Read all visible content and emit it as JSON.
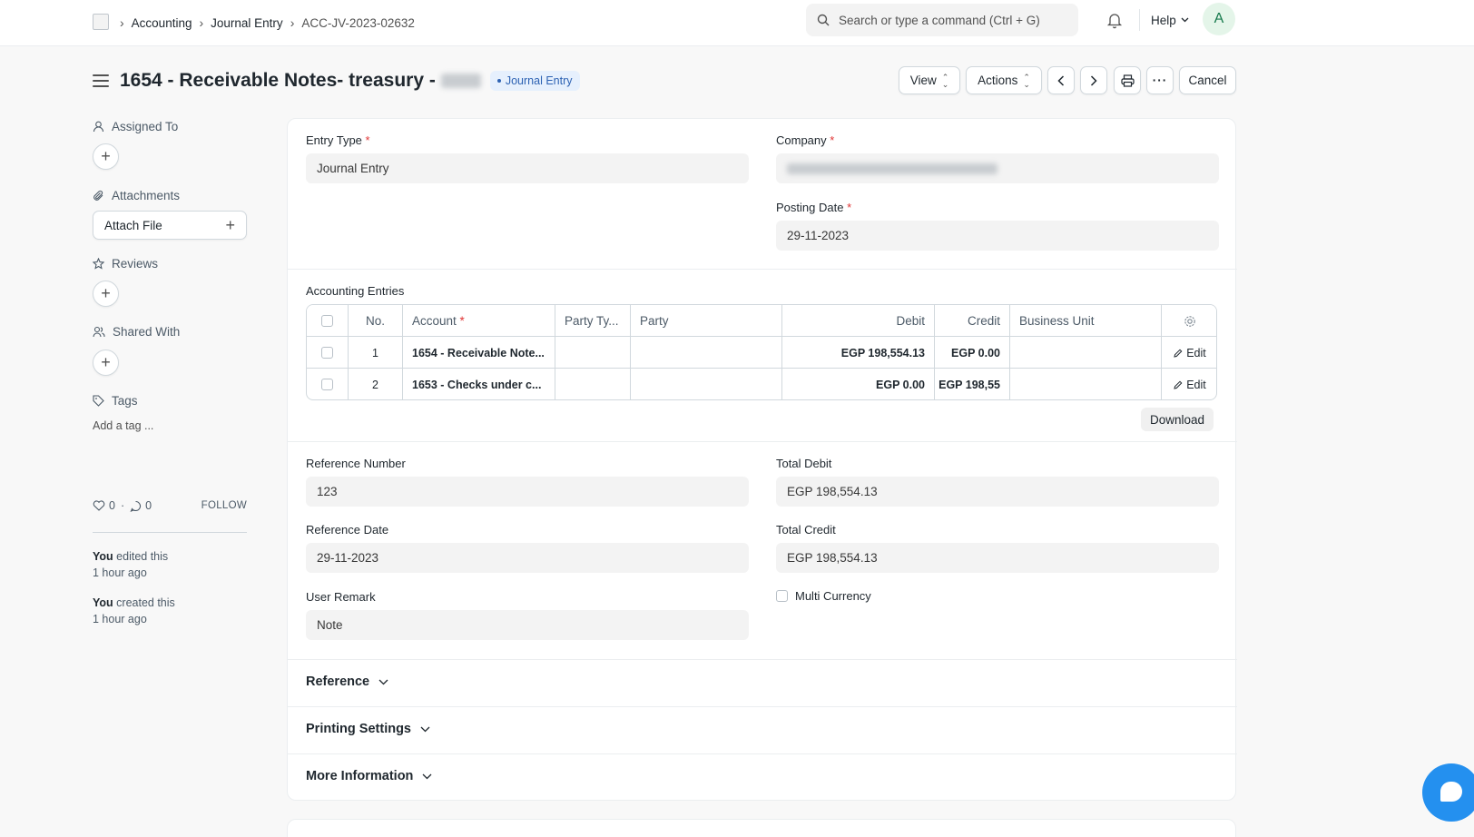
{
  "navbar": {
    "breadcrumbs": [
      "Accounting",
      "Journal Entry",
      "ACC-JV-2023-02632"
    ],
    "search_placeholder": "Search or type a command (Ctrl + G)",
    "help_label": "Help",
    "avatar_initial": "A"
  },
  "header": {
    "title": "1654 - Receivable Notes- treasury -",
    "status": "Journal Entry",
    "buttons": {
      "view": "View",
      "actions": "Actions",
      "cancel": "Cancel",
      "more": "···"
    }
  },
  "sidebar": {
    "assigned_to": "Assigned To",
    "attachments": "Attachments",
    "attach_file": "Attach File",
    "reviews": "Reviews",
    "shared_with": "Shared With",
    "tags": "Tags",
    "add_tag": "Add a tag ...",
    "likes": "0",
    "comments": "0",
    "follow": "FOLLOW",
    "activity": [
      {
        "who": "You",
        "action": " edited this",
        "when": "1 hour ago"
      },
      {
        "who": "You",
        "action": " created this",
        "when": "1 hour ago"
      }
    ]
  },
  "form": {
    "entry_type": {
      "label": "Entry Type",
      "value": "Journal Entry"
    },
    "company": {
      "label": "Company"
    },
    "posting_date": {
      "label": "Posting Date",
      "value": "29-11-2023"
    },
    "accounting_entries": {
      "label": "Accounting Entries",
      "columns": [
        "No.",
        "Account",
        "Party Ty...",
        "Party",
        "Debit",
        "Credit",
        "Business Unit"
      ],
      "rows": [
        {
          "no": "1",
          "account": "1654 - Receivable Note...",
          "party_type": "",
          "party": "",
          "debit": "EGP 198,554.13",
          "credit": "EGP 0.00",
          "business_unit": "",
          "edit": "Edit"
        },
        {
          "no": "2",
          "account": "1653 - Checks under c...",
          "party_type": "",
          "party": "",
          "debit": "EGP 0.00",
          "credit": "EGP 198,55",
          "business_unit": "",
          "edit": "Edit"
        }
      ],
      "download": "Download"
    },
    "reference_number": {
      "label": "Reference Number",
      "value": "123"
    },
    "total_debit": {
      "label": "Total Debit",
      "value": "EGP 198,554.13"
    },
    "reference_date": {
      "label": "Reference Date",
      "value": "29-11-2023"
    },
    "total_credit": {
      "label": "Total Credit",
      "value": "EGP 198,554.13"
    },
    "user_remark": {
      "label": "User Remark",
      "value": "Note"
    },
    "multi_currency": {
      "label": "Multi Currency"
    },
    "sections": [
      "Reference",
      "Printing Settings",
      "More Information"
    ]
  }
}
